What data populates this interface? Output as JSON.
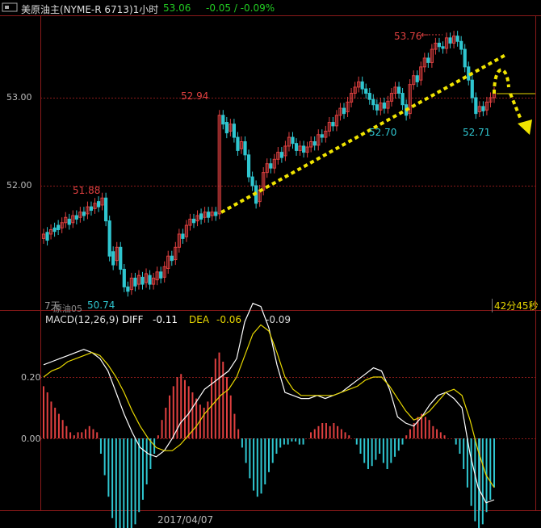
{
  "header": {
    "icon": "window-toggle-icon",
    "title": "美原油主(NYME-R 6713)1小时",
    "price": "53.06",
    "change": "-0.05 / -0.09%"
  },
  "colors": {
    "up": "#e04040",
    "down": "#2fc6d0",
    "grid": "#8a1a1a",
    "axis_text": "#bbbbbb",
    "ma_white": "#ffffff",
    "ma_yellow": "#e8d800",
    "annotation_yellow": "#f0e400",
    "header_green": "#22cc22"
  },
  "main_panel": {
    "y_ticks": [
      "53.00",
      "52.00"
    ],
    "price_labels": {
      "low_left": "50.74",
      "peak_1": "51.88",
      "peak_2": "52.94",
      "low_mid": "52.70",
      "peak_top": "53.76",
      "low_right": "52.71"
    },
    "left_bottom_label": "7天",
    "left_bottom_label2": "原油05",
    "countdown": "42分45秒"
  },
  "macd_panel": {
    "title": "MACD(12,26,9)",
    "diff_label": "DIFF",
    "diff_value": "-0.11",
    "dea_label": "DEA",
    "dea_value": "-0.06",
    "macd_value": "-0.09",
    "y_ticks": [
      "0.20",
      "0.00"
    ],
    "date_label": "2017/04/07"
  },
  "chart_data": [
    {
      "type": "candlestick",
      "title": "美原油主(NYME-R 6713)1小时",
      "ylim": [
        50.55,
        53.92
      ],
      "y_ticks": [
        52.0,
        53.0
      ],
      "points": [
        [
          51.4,
          51.45
        ],
        [
          51.47,
          51.38
        ],
        [
          51.45,
          51.5
        ],
        [
          51.52,
          51.48
        ],
        [
          51.55,
          51.5
        ],
        [
          51.52,
          51.58
        ],
        [
          51.58,
          51.64
        ],
        [
          51.62,
          51.56
        ],
        [
          51.58,
          51.66
        ],
        [
          51.66,
          51.62
        ],
        [
          51.64,
          51.7
        ],
        [
          51.7,
          51.66
        ],
        [
          51.68,
          51.76
        ],
        [
          51.76,
          51.72
        ],
        [
          51.74,
          51.8
        ],
        [
          51.82,
          51.76
        ],
        [
          51.78,
          51.86
        ],
        [
          51.86,
          51.6
        ],
        [
          51.6,
          51.2
        ],
        [
          51.25,
          51.1
        ],
        [
          51.15,
          51.3
        ],
        [
          51.3,
          51.05
        ],
        [
          51.05,
          50.85
        ],
        [
          50.85,
          50.8
        ],
        [
          50.82,
          50.95
        ],
        [
          50.95,
          50.86
        ],
        [
          50.88,
          50.98
        ],
        [
          50.96,
          50.88
        ],
        [
          50.9,
          51.0
        ],
        [
          50.98,
          50.88
        ],
        [
          50.88,
          50.95
        ],
        [
          50.93,
          51.02
        ],
        [
          51.02,
          50.95
        ],
        [
          50.96,
          51.08
        ],
        [
          51.06,
          51.2
        ],
        [
          51.2,
          51.15
        ],
        [
          51.16,
          51.3
        ],
        [
          51.3,
          51.45
        ],
        [
          51.45,
          51.4
        ],
        [
          51.42,
          51.55
        ],
        [
          51.55,
          51.62
        ],
        [
          51.62,
          51.58
        ],
        [
          51.6,
          51.66
        ],
        [
          51.68,
          51.62
        ],
        [
          51.64,
          51.7
        ],
        [
          51.7,
          51.64
        ],
        [
          51.66,
          51.7
        ],
        [
          51.7,
          51.66
        ],
        [
          51.68,
          52.8
        ],
        [
          52.8,
          52.7
        ],
        [
          52.72,
          52.6
        ],
        [
          52.62,
          52.7
        ],
        [
          52.7,
          52.55
        ],
        [
          52.55,
          52.4
        ],
        [
          52.42,
          52.5
        ],
        [
          52.5,
          52.35
        ],
        [
          52.35,
          52.1
        ],
        [
          52.1,
          52.0
        ],
        [
          52.0,
          51.8
        ],
        [
          51.82,
          51.95
        ],
        [
          51.95,
          52.15
        ],
        [
          52.15,
          52.25
        ],
        [
          52.25,
          52.2
        ],
        [
          52.2,
          52.3
        ],
        [
          52.3,
          52.38
        ],
        [
          52.38,
          52.32
        ],
        [
          52.34,
          52.45
        ],
        [
          52.45,
          52.55
        ],
        [
          52.55,
          52.48
        ],
        [
          52.48,
          52.4
        ],
        [
          52.4,
          52.45
        ],
        [
          52.45,
          52.38
        ],
        [
          52.38,
          52.44
        ],
        [
          52.44,
          52.5
        ],
        [
          52.5,
          52.46
        ],
        [
          52.46,
          52.58
        ],
        [
          52.58,
          52.55
        ],
        [
          52.55,
          52.62
        ],
        [
          52.62,
          52.72
        ],
        [
          52.72,
          52.68
        ],
        [
          52.68,
          52.8
        ],
        [
          52.8,
          52.88
        ],
        [
          52.88,
          52.82
        ],
        [
          52.84,
          52.95
        ],
        [
          52.95,
          53.05
        ],
        [
          53.05,
          53.12
        ],
        [
          53.12,
          53.18
        ],
        [
          53.18,
          53.1
        ],
        [
          53.1,
          53.05
        ],
        [
          53.05,
          52.98
        ],
        [
          52.98,
          52.92
        ],
        [
          52.92,
          52.86
        ],
        [
          52.86,
          52.94
        ],
        [
          52.94,
          52.88
        ],
        [
          52.88,
          52.96
        ],
        [
          52.96,
          53.05
        ],
        [
          53.05,
          53.12
        ],
        [
          53.12,
          53.05
        ],
        [
          53.05,
          52.92
        ],
        [
          52.92,
          52.8
        ],
        [
          52.82,
          53.15
        ],
        [
          53.15,
          53.25
        ],
        [
          53.25,
          53.18
        ],
        [
          53.2,
          53.35
        ],
        [
          53.35,
          53.45
        ],
        [
          53.45,
          53.4
        ],
        [
          53.4,
          53.55
        ],
        [
          53.55,
          53.62
        ],
        [
          53.62,
          53.58
        ],
        [
          53.58,
          53.56
        ],
        [
          53.56,
          53.68
        ],
        [
          53.68,
          53.62
        ],
        [
          53.62,
          53.7
        ],
        [
          53.7,
          53.64
        ],
        [
          53.64,
          53.55
        ],
        [
          53.55,
          53.35
        ],
        [
          53.35,
          53.2
        ],
        [
          53.2,
          53.0
        ],
        [
          53.0,
          52.82
        ],
        [
          52.84,
          52.9
        ],
        [
          52.9,
          52.85
        ],
        [
          52.86,
          52.95
        ],
        [
          52.95,
          53.0
        ],
        [
          53.0,
          53.06
        ]
      ],
      "annotations": {
        "lows": [
          50.74,
          52.7,
          52.71
        ],
        "highs": [
          51.88,
          52.94,
          53.76
        ]
      }
    },
    {
      "type": "bar+line",
      "title": "MACD(12,26,9)",
      "ylim": [
        -0.42,
        0.63
      ],
      "y_ticks": [
        0.0,
        0.2
      ],
      "macd_hist": [
        0.17,
        0.15,
        0.12,
        0.1,
        0.08,
        0.06,
        0.04,
        0.02,
        0.01,
        0.02,
        0.02,
        0.03,
        0.04,
        0.03,
        0.02,
        -0.05,
        -0.12,
        -0.19,
        -0.26,
        -0.32,
        -0.35,
        -0.36,
        -0.34,
        -0.32,
        -0.28,
        -0.24,
        -0.2,
        -0.15,
        -0.1,
        -0.05,
        0.01,
        0.06,
        0.1,
        0.14,
        0.17,
        0.2,
        0.21,
        0.19,
        0.17,
        0.15,
        0.13,
        0.11,
        0.1,
        0.12,
        0.2,
        0.26,
        0.28,
        0.25,
        0.2,
        0.14,
        0.08,
        0.03,
        -0.03,
        -0.08,
        -0.13,
        -0.17,
        -0.19,
        -0.18,
        -0.15,
        -0.11,
        -0.08,
        -0.05,
        -0.03,
        -0.02,
        -0.02,
        -0.01,
        -0.01,
        -0.02,
        -0.02,
        0.0,
        0.02,
        0.03,
        0.04,
        0.05,
        0.05,
        0.04,
        0.05,
        0.04,
        0.03,
        0.02,
        0.01,
        0.0,
        -0.02,
        -0.05,
        -0.08,
        -0.1,
        -0.09,
        -0.07,
        -0.05,
        -0.08,
        -0.1,
        -0.08,
        -0.06,
        -0.04,
        -0.02,
        0.01,
        0.03,
        0.05,
        0.07,
        0.08,
        0.07,
        0.06,
        0.04,
        0.03,
        0.02,
        0.01,
        0.0,
        0.0,
        -0.02,
        -0.05,
        -0.1,
        -0.16,
        -0.22,
        -0.27,
        -0.3,
        -0.28,
        -0.24,
        -0.2,
        -0.16
      ],
      "series": [
        {
          "name": "DIFF",
          "values": [
            0.24,
            0.25,
            0.26,
            0.27,
            0.28,
            0.29,
            0.28,
            0.26,
            0.22,
            0.15,
            0.08,
            0.02,
            -0.03,
            -0.05,
            -0.06,
            -0.04,
            0.0,
            0.05,
            0.08,
            0.12,
            0.16,
            0.18,
            0.2,
            0.22,
            0.26,
            0.38,
            0.44,
            0.43,
            0.36,
            0.24,
            0.15,
            0.14,
            0.13,
            0.13,
            0.14,
            0.13,
            0.14,
            0.15,
            0.17,
            0.19,
            0.21,
            0.23,
            0.22,
            0.16,
            0.07,
            0.05,
            0.04,
            0.07,
            0.11,
            0.14,
            0.15,
            0.13,
            0.1,
            -0.05,
            -0.16,
            -0.21,
            -0.2
          ]
        },
        {
          "name": "DEA",
          "values": [
            0.2,
            0.22,
            0.23,
            0.25,
            0.26,
            0.27,
            0.28,
            0.27,
            0.24,
            0.2,
            0.15,
            0.09,
            0.04,
            0.0,
            -0.03,
            -0.04,
            -0.04,
            -0.02,
            0.01,
            0.04,
            0.08,
            0.11,
            0.14,
            0.16,
            0.2,
            0.27,
            0.34,
            0.37,
            0.35,
            0.28,
            0.2,
            0.16,
            0.14,
            0.14,
            0.14,
            0.14,
            0.14,
            0.15,
            0.16,
            0.17,
            0.19,
            0.2,
            0.2,
            0.17,
            0.13,
            0.09,
            0.06,
            0.07,
            0.09,
            0.12,
            0.15,
            0.16,
            0.14,
            0.06,
            -0.04,
            -0.12,
            -0.16
          ]
        }
      ]
    }
  ]
}
